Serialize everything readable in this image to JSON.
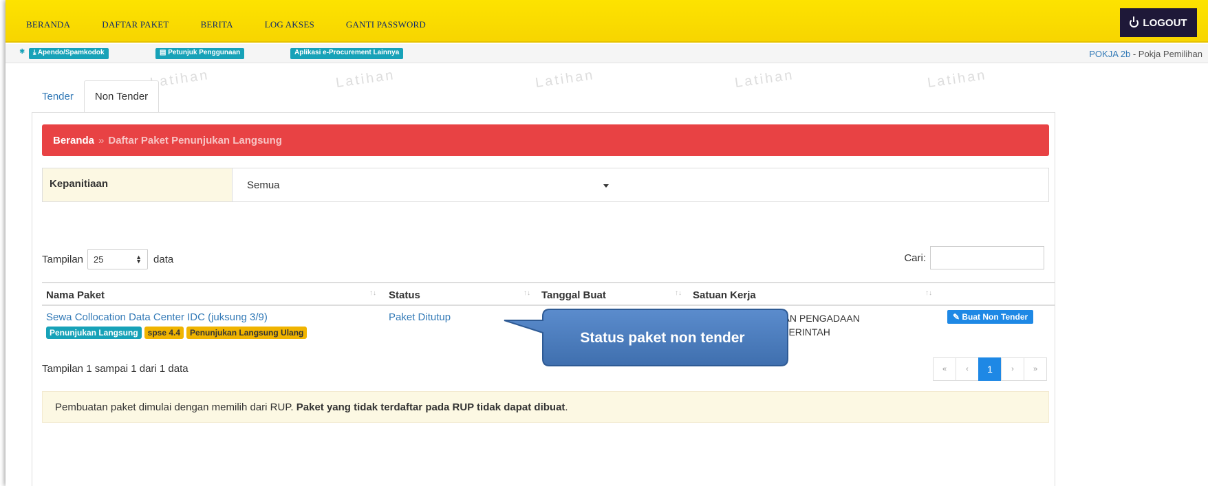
{
  "topnav": {
    "menu": [
      "BERANDA",
      "DAFTAR PAKET",
      "BERITA",
      "LOG AKSES",
      "GANTI PASSWORD"
    ],
    "logout": "LOGOUT"
  },
  "subbar": {
    "links": [
      "Apendo/Spamkodok",
      "Petunjuk Penggunaan",
      "Aplikasi e-Procurement Lainnya"
    ],
    "user_name": "POKJA 2b",
    "user_role": " - Pokja Pemilihan"
  },
  "watermark": "Latihan",
  "tabs": [
    "Tender",
    "Non Tender"
  ],
  "breadcrumb": {
    "home": "Beranda",
    "separator": "»",
    "current": "Daftar Paket Penunjukan Langsung"
  },
  "filter": {
    "label": "Kepanitiaan",
    "value": "Semua"
  },
  "length": {
    "prefix": "Tampilan",
    "value": "25",
    "suffix": "data"
  },
  "search": {
    "label": "Cari:",
    "value": ""
  },
  "table": {
    "headers": [
      "Nama Paket",
      "Status",
      "Tanggal Buat",
      "Satuan Kerja"
    ],
    "rows": [
      {
        "name": "Sewa Collocation Data Center IDC (juksung 3/9)",
        "badges": [
          "Penunjukan Langsung",
          "spse 4.4",
          "Penunjukan Langsung Ulang"
        ],
        "status": "Paket Ditutup",
        "satker_line1": "KEBIJAKAN PENGADAAN",
        "satker_line2": "ASA PEMERINTAH",
        "action": "Buat Non Tender"
      }
    ]
  },
  "info": "Tampilan 1 sampai 1 dari 1 data",
  "pager": [
    "«",
    "‹",
    "1",
    "›",
    "»"
  ],
  "note": {
    "text": "Pembuatan paket dimulai dengan memilih dari RUP. ",
    "bold": "Paket yang tidak terdaftar pada RUP tidak dapat dibuat",
    "end": "."
  },
  "callout": {
    "text": "Status paket non tender"
  },
  "colors": {
    "nav": "#fde300",
    "breadcrumb": "#e84244",
    "badge_teal": "#17a2b8",
    "badge_gold": "#f0b400",
    "callout": "#4f7fc1"
  }
}
